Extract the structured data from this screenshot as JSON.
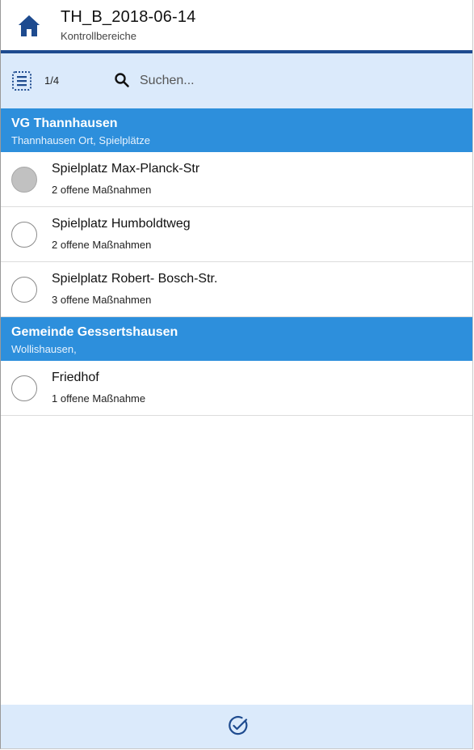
{
  "header": {
    "title": "TH_B_2018-06-14",
    "subtitle": "Kontrollbereiche",
    "home_icon": "home-icon",
    "accent_color": "#1e4b8f"
  },
  "toolbar": {
    "list_icon": "list-icon",
    "page_count": "1/4",
    "search_icon": "search-icon",
    "search_placeholder": "Suchen..."
  },
  "groups": [
    {
      "title": "VG Thannhausen",
      "subtitle": "Thannhausen Ort, Spielplätze",
      "items": [
        {
          "name": "Spielplatz Max-Planck-Str",
          "count": "2 offene Maßnahmen",
          "selected": true
        },
        {
          "name": "Spielplatz Humboldtweg",
          "count": "2 offene Maßnahmen",
          "selected": false
        },
        {
          "name": "Spielplatz Robert- Bosch-Str.",
          "count": "3 offene Maßnahmen",
          "selected": false
        }
      ]
    },
    {
      "title": "Gemeinde Gessertshausen",
      "subtitle": "Wollishausen,",
      "items": [
        {
          "name": "Friedhof",
          "count": "1 offene Maßnahme",
          "selected": false
        }
      ]
    }
  ],
  "bottom_bar": {
    "confirm_icon": "check-circle-icon"
  },
  "colors": {
    "group_header": "#2d8fdc",
    "toolbar_bg": "#dbeafb",
    "selected_radio": "#c1c1c1"
  }
}
